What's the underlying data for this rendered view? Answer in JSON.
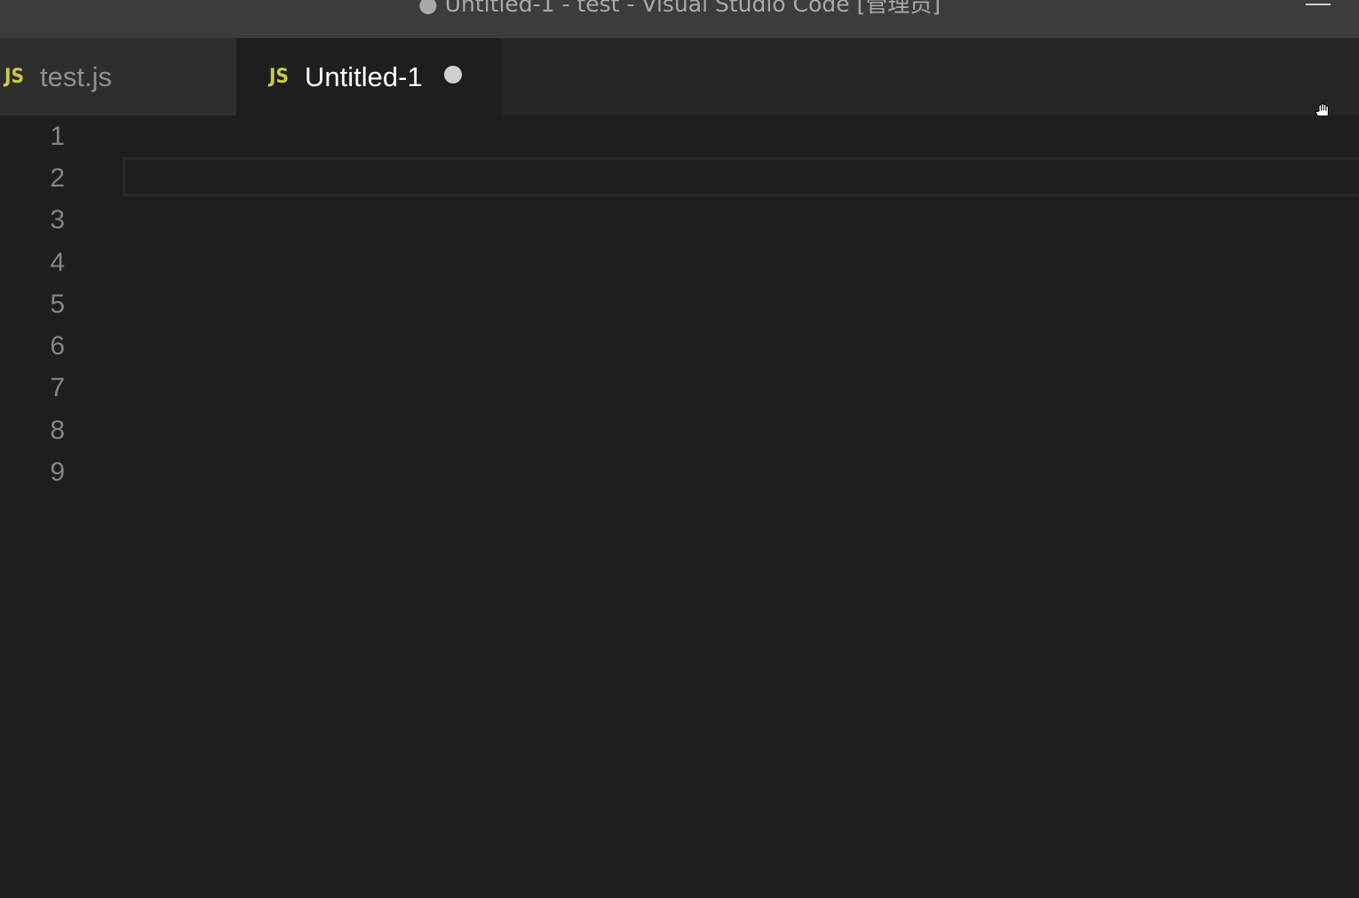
{
  "window": {
    "title": "● Untitled-1 - test - Visual Studio Code [管理员]"
  },
  "tabs": [
    {
      "icon": "JS",
      "label": "test.js",
      "active": false,
      "dirty": false
    },
    {
      "icon": "JS",
      "label": "Untitled-1",
      "active": true,
      "dirty": true
    }
  ],
  "editor": {
    "line_numbers": [
      "1",
      "2",
      "3",
      "4",
      "5",
      "6",
      "7",
      "8",
      "9"
    ],
    "current_line": "2"
  },
  "colors": {
    "js_icon": "#cbcb41",
    "editor_background": "#1e1e1e",
    "title_bar": "#3c3c3c"
  },
  "icons": {
    "tab_icon": "javascript-file-icon",
    "cursor": "hand-cursor-icon",
    "window_control": "minimize-icon",
    "unsaved": "unsaved-dot-icon"
  }
}
